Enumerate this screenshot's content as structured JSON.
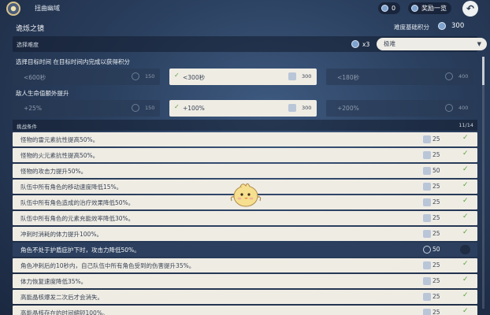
{
  "header": {
    "title": "扭曲幽域",
    "currency_value": "0",
    "reward_button": "奖励一览",
    "back_icon": "back-arrow-icon"
  },
  "page": {
    "title": "诡烁之镜",
    "score_label": "难度基础积分",
    "score_value": "300"
  },
  "difficulty": {
    "label": "选择难度",
    "multiplier": "x3",
    "selected": "极难",
    "dropdown_icon": "chevron-down-icon"
  },
  "time_section": {
    "label": "选择目标时间 在目标时间内完成以获得积分",
    "options": [
      {
        "text": "<600秒",
        "value": "150",
        "selected": false
      },
      {
        "text": "<300秒",
        "value": "300",
        "selected": true
      },
      {
        "text": "<180秒",
        "value": "400",
        "selected": false
      }
    ]
  },
  "hp_section": {
    "label": "敌人生命值额外提升",
    "options": [
      {
        "text": "+25%",
        "value": "150",
        "selected": false
      },
      {
        "text": "+100%",
        "value": "300",
        "selected": true
      },
      {
        "text": "+200%",
        "value": "400",
        "selected": false
      }
    ]
  },
  "conditions": {
    "header": "挑战条件",
    "count": "11/14",
    "items": [
      {
        "text": "怪物的雷元素抗性提高50%。",
        "value": "25",
        "checked": true
      },
      {
        "text": "怪物的火元素抗性提高50%。",
        "value": "25",
        "checked": true
      },
      {
        "text": "怪物的攻击力提升50%。",
        "value": "50",
        "checked": true
      },
      {
        "text": "队伍中所有角色的移动速度降低15%。",
        "value": "25",
        "checked": true
      },
      {
        "text": "队伍中所有角色造成的治疗效果降低50%。",
        "value": "25",
        "checked": true
      },
      {
        "text": "队伍中所有角色的元素充能效率降低30%。",
        "value": "25",
        "checked": true
      },
      {
        "text": "冲刺时消耗的体力提升100%。",
        "value": "25",
        "checked": true
      },
      {
        "text": "角色不处于护盾庇护下时，攻击力降低50%。",
        "value": "50",
        "checked": false
      },
      {
        "text": "角色冲刺后的10秒内，自己队伍中所有角色受到的伤害提升35%。",
        "value": "25",
        "checked": true
      },
      {
        "text": "体力恢复速度降低35%。",
        "value": "25",
        "checked": true
      },
      {
        "text": "高能晶核爆发二次后才会消失。",
        "value": "25",
        "checked": true
      },
      {
        "text": "高能晶核存在的时间缩短100%。",
        "value": "25",
        "checked": true
      }
    ]
  },
  "colors": {
    "accent_check": "#59a33b",
    "option_selected_bg": "#efece4",
    "bg_dark": "#2a3f5e"
  }
}
